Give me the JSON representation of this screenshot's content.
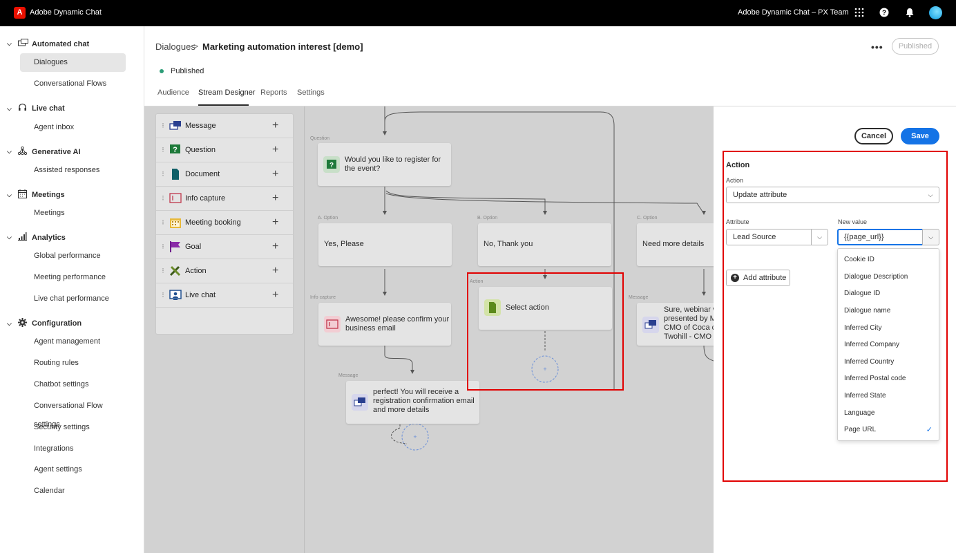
{
  "app": {
    "title": "Adobe Dynamic Chat",
    "org": "Adobe Dynamic Chat – PX Team",
    "logo_letter": "A"
  },
  "topbar_icons": [
    "apps-grid-icon",
    "help-icon",
    "bell-icon",
    "avatar"
  ],
  "sidebar": {
    "sections": [
      {
        "label": "Automated chat",
        "icon": "chat-bubbles-icon",
        "items": [
          "Dialogues",
          "Conversational Flows"
        ]
      },
      {
        "label": "Live chat",
        "icon": "headset-icon",
        "items": [
          "Agent inbox"
        ]
      },
      {
        "label": "Generative AI",
        "icon": "network-icon",
        "items": [
          "Assisted responses"
        ]
      },
      {
        "label": "Meetings",
        "icon": "calendar-icon",
        "items": [
          "Meetings"
        ]
      },
      {
        "label": "Analytics",
        "icon": "bar-chart-icon",
        "items": [
          "Global performance",
          "Meeting performance",
          "Live chat performance"
        ]
      },
      {
        "label": "Configuration",
        "icon": "gear-icon",
        "items": [
          "Agent management",
          "Routing rules",
          "Chatbot settings",
          "Conversational Flow settings",
          "Security settings",
          "Integrations",
          "Agent settings",
          "Calendar"
        ]
      }
    ],
    "active_item": "Dialogues"
  },
  "header": {
    "breadcrumb_root": "Dialogues",
    "breadcrumb_sep": ">",
    "breadcrumb_current": "Marketing automation interest [demo]",
    "status": "Published",
    "status_color": "#2d9d78",
    "more": "•••",
    "published_button": "Published",
    "tabs": [
      "Audience",
      "Stream Designer",
      "Reports",
      "Settings"
    ],
    "active_tab": "Stream Designer"
  },
  "palette": [
    {
      "label": "Message",
      "icon": "message-icon"
    },
    {
      "label": "Question",
      "icon": "question-icon"
    },
    {
      "label": "Document",
      "icon": "document-icon"
    },
    {
      "label": "Info capture",
      "icon": "info-capture-icon"
    },
    {
      "label": "Meeting booking",
      "icon": "meeting-booking-icon"
    },
    {
      "label": "Goal",
      "icon": "flag-icon"
    },
    {
      "label": "Action",
      "icon": "action-tools-icon"
    },
    {
      "label": "Live chat",
      "icon": "live-chat-icon"
    }
  ],
  "flow": {
    "question": {
      "tag": "Question",
      "text1": "Would you like to register for",
      "text2": "the event?"
    },
    "option_a": {
      "tag": "A. Option",
      "text": "Yes, Please"
    },
    "option_b": {
      "tag": "B. Option",
      "text": "No, Thank you"
    },
    "option_c": {
      "tag": "C. Option",
      "text": "Need more details"
    },
    "info_capture": {
      "tag": "Info capture",
      "text1": "Awesome! please confirm your",
      "text2": "business email"
    },
    "action": {
      "tag": "Action",
      "text": "Select action"
    },
    "message_right": {
      "tag": "Message",
      "text1": "Sure, webinar w",
      "text2": "presented by M",
      "text3": "CMO of Coca co",
      "text4": "Twohill - CMO o"
    },
    "message_bottom": {
      "tag": "Message",
      "text1": "perfect! You will receive a",
      "text2": "registration confirmation email",
      "text3": "and more details"
    }
  },
  "panel": {
    "cancel": "Cancel",
    "save": "Save",
    "title": "Action",
    "action_label": "Action",
    "action_value": "Update attribute",
    "attribute_label": "Attribute",
    "attribute_value": "Lead Source",
    "new_value_label": "New value",
    "new_value": "{{page_url}}",
    "add_attribute": "Add attribute",
    "options": [
      "Cookie ID",
      "Dialogue Description",
      "Dialogue ID",
      "Dialogue name",
      "Inferred City",
      "Inferred Company",
      "Inferred Country",
      "Inferred Postal code",
      "Inferred State",
      "Language",
      "Page URL"
    ],
    "selected_option": "Page URL",
    "accent_color": "#1473e6",
    "highlight_color": "#e10000"
  }
}
